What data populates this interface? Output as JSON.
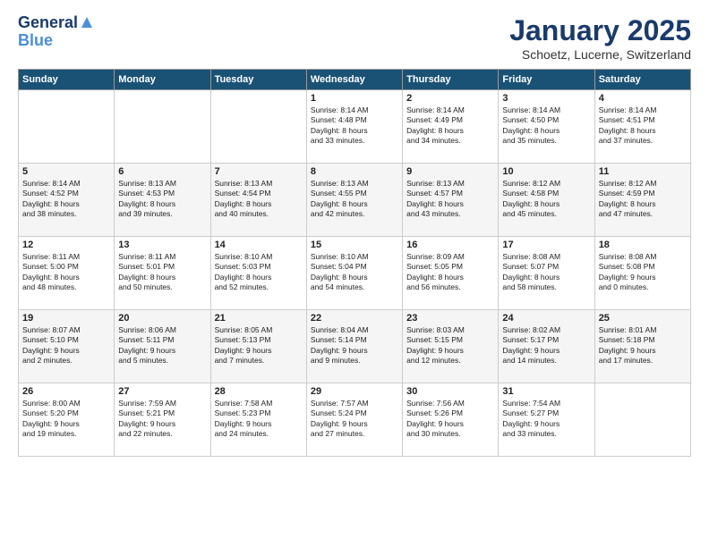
{
  "logo": {
    "line1": "General",
    "line2": "Blue"
  },
  "title": "January 2025",
  "subtitle": "Schoetz, Lucerne, Switzerland",
  "weekdays": [
    "Sunday",
    "Monday",
    "Tuesday",
    "Wednesday",
    "Thursday",
    "Friday",
    "Saturday"
  ],
  "weeks": [
    [
      {
        "day": "",
        "info": ""
      },
      {
        "day": "",
        "info": ""
      },
      {
        "day": "",
        "info": ""
      },
      {
        "day": "1",
        "info": "Sunrise: 8:14 AM\nSunset: 4:48 PM\nDaylight: 8 hours\nand 33 minutes."
      },
      {
        "day": "2",
        "info": "Sunrise: 8:14 AM\nSunset: 4:49 PM\nDaylight: 8 hours\nand 34 minutes."
      },
      {
        "day": "3",
        "info": "Sunrise: 8:14 AM\nSunset: 4:50 PM\nDaylight: 8 hours\nand 35 minutes."
      },
      {
        "day": "4",
        "info": "Sunrise: 8:14 AM\nSunset: 4:51 PM\nDaylight: 8 hours\nand 37 minutes."
      }
    ],
    [
      {
        "day": "5",
        "info": "Sunrise: 8:14 AM\nSunset: 4:52 PM\nDaylight: 8 hours\nand 38 minutes."
      },
      {
        "day": "6",
        "info": "Sunrise: 8:13 AM\nSunset: 4:53 PM\nDaylight: 8 hours\nand 39 minutes."
      },
      {
        "day": "7",
        "info": "Sunrise: 8:13 AM\nSunset: 4:54 PM\nDaylight: 8 hours\nand 40 minutes."
      },
      {
        "day": "8",
        "info": "Sunrise: 8:13 AM\nSunset: 4:55 PM\nDaylight: 8 hours\nand 42 minutes."
      },
      {
        "day": "9",
        "info": "Sunrise: 8:13 AM\nSunset: 4:57 PM\nDaylight: 8 hours\nand 43 minutes."
      },
      {
        "day": "10",
        "info": "Sunrise: 8:12 AM\nSunset: 4:58 PM\nDaylight: 8 hours\nand 45 minutes."
      },
      {
        "day": "11",
        "info": "Sunrise: 8:12 AM\nSunset: 4:59 PM\nDaylight: 8 hours\nand 47 minutes."
      }
    ],
    [
      {
        "day": "12",
        "info": "Sunrise: 8:11 AM\nSunset: 5:00 PM\nDaylight: 8 hours\nand 48 minutes."
      },
      {
        "day": "13",
        "info": "Sunrise: 8:11 AM\nSunset: 5:01 PM\nDaylight: 8 hours\nand 50 minutes."
      },
      {
        "day": "14",
        "info": "Sunrise: 8:10 AM\nSunset: 5:03 PM\nDaylight: 8 hours\nand 52 minutes."
      },
      {
        "day": "15",
        "info": "Sunrise: 8:10 AM\nSunset: 5:04 PM\nDaylight: 8 hours\nand 54 minutes."
      },
      {
        "day": "16",
        "info": "Sunrise: 8:09 AM\nSunset: 5:05 PM\nDaylight: 8 hours\nand 56 minutes."
      },
      {
        "day": "17",
        "info": "Sunrise: 8:08 AM\nSunset: 5:07 PM\nDaylight: 8 hours\nand 58 minutes."
      },
      {
        "day": "18",
        "info": "Sunrise: 8:08 AM\nSunset: 5:08 PM\nDaylight: 9 hours\nand 0 minutes."
      }
    ],
    [
      {
        "day": "19",
        "info": "Sunrise: 8:07 AM\nSunset: 5:10 PM\nDaylight: 9 hours\nand 2 minutes."
      },
      {
        "day": "20",
        "info": "Sunrise: 8:06 AM\nSunset: 5:11 PM\nDaylight: 9 hours\nand 5 minutes."
      },
      {
        "day": "21",
        "info": "Sunrise: 8:05 AM\nSunset: 5:13 PM\nDaylight: 9 hours\nand 7 minutes."
      },
      {
        "day": "22",
        "info": "Sunrise: 8:04 AM\nSunset: 5:14 PM\nDaylight: 9 hours\nand 9 minutes."
      },
      {
        "day": "23",
        "info": "Sunrise: 8:03 AM\nSunset: 5:15 PM\nDaylight: 9 hours\nand 12 minutes."
      },
      {
        "day": "24",
        "info": "Sunrise: 8:02 AM\nSunset: 5:17 PM\nDaylight: 9 hours\nand 14 minutes."
      },
      {
        "day": "25",
        "info": "Sunrise: 8:01 AM\nSunset: 5:18 PM\nDaylight: 9 hours\nand 17 minutes."
      }
    ],
    [
      {
        "day": "26",
        "info": "Sunrise: 8:00 AM\nSunset: 5:20 PM\nDaylight: 9 hours\nand 19 minutes."
      },
      {
        "day": "27",
        "info": "Sunrise: 7:59 AM\nSunset: 5:21 PM\nDaylight: 9 hours\nand 22 minutes."
      },
      {
        "day": "28",
        "info": "Sunrise: 7:58 AM\nSunset: 5:23 PM\nDaylight: 9 hours\nand 24 minutes."
      },
      {
        "day": "29",
        "info": "Sunrise: 7:57 AM\nSunset: 5:24 PM\nDaylight: 9 hours\nand 27 minutes."
      },
      {
        "day": "30",
        "info": "Sunrise: 7:56 AM\nSunset: 5:26 PM\nDaylight: 9 hours\nand 30 minutes."
      },
      {
        "day": "31",
        "info": "Sunrise: 7:54 AM\nSunset: 5:27 PM\nDaylight: 9 hours\nand 33 minutes."
      },
      {
        "day": "",
        "info": ""
      }
    ]
  ]
}
